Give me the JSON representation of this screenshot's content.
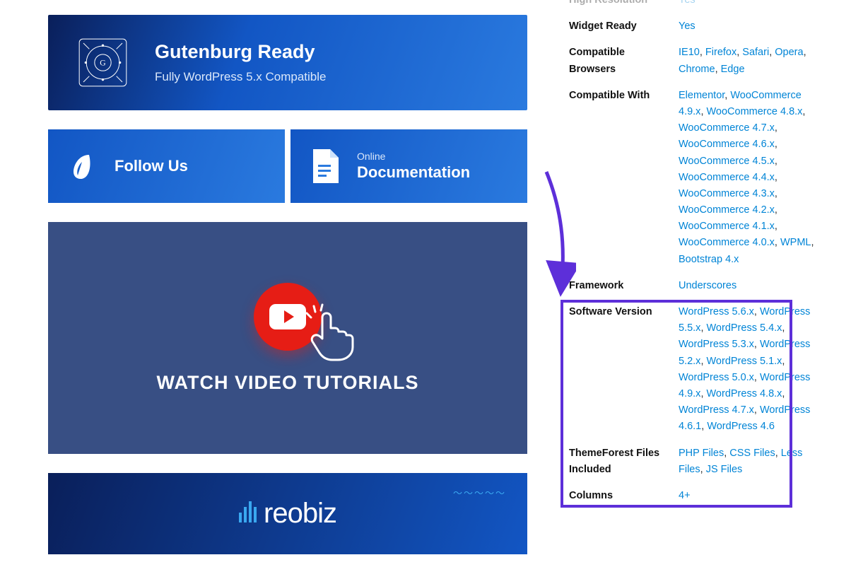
{
  "left": {
    "gutenburg": {
      "title": "Gutenburg Ready",
      "subtitle": "Fully WordPress 5.x Compatible"
    },
    "follow": {
      "label": "Follow Us"
    },
    "docs": {
      "small": "Online",
      "big": "Documentation"
    },
    "video": {
      "title": "WATCH VIDEO TUTORIALS"
    },
    "reobiz": {
      "name": "reobiz"
    }
  },
  "specs": {
    "rows": [
      {
        "label": "High Resolution",
        "links": [
          "Yes"
        ]
      },
      {
        "label": "Widget Ready",
        "links": [
          "Yes"
        ]
      },
      {
        "label": "Compatible Browsers",
        "links": [
          "IE10",
          "Firefox",
          "Safari",
          "Opera",
          "Chrome",
          "Edge"
        ]
      },
      {
        "label": "Compatible With",
        "links": [
          "Elementor",
          "WooCommerce 4.9.x",
          "WooCommerce 4.8.x",
          "WooCommerce 4.7.x",
          "WooCommerce 4.6.x",
          "WooCommerce 4.5.x",
          "WooCommerce 4.4.x",
          "WooCommerce 4.3.x",
          "WooCommerce 4.2.x",
          "WooCommerce 4.1.x",
          "WooCommerce 4.0.x",
          "WPML",
          "Bootstrap 4.x"
        ]
      },
      {
        "label": "Framework",
        "links": [
          "Underscores"
        ]
      },
      {
        "label": "Software Version",
        "links": [
          "WordPress 5.6.x",
          "WordPress 5.5.x",
          "WordPress 5.4.x",
          "WordPress 5.3.x",
          "WordPress 5.2.x",
          "WordPress 5.1.x",
          "WordPress 5.0.x",
          "WordPress 4.9.x",
          "WordPress 4.8.x",
          "WordPress 4.7.x",
          "WordPress 4.6.1",
          "WordPress 4.6"
        ]
      },
      {
        "label": "ThemeForest Files Included",
        "links": [
          "PHP Files",
          "CSS Files",
          "Less Files",
          "JS Files"
        ]
      },
      {
        "label": "Columns",
        "links": [
          "4+"
        ]
      }
    ]
  }
}
